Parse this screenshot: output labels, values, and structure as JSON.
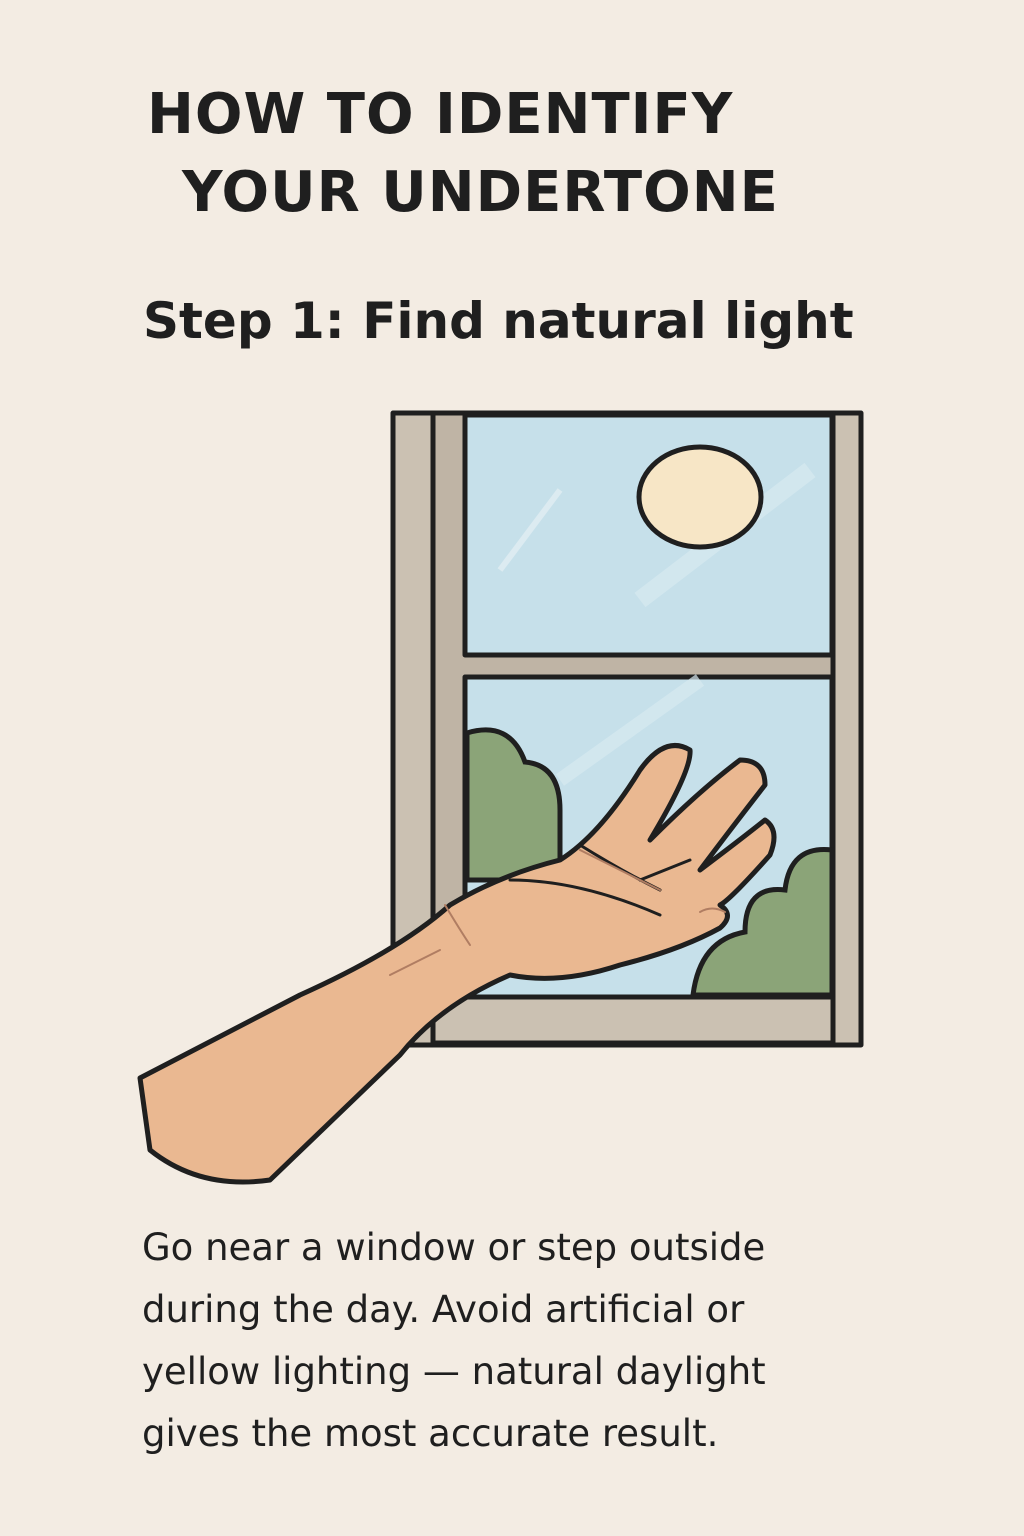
{
  "header": {
    "title_line1": "HOW TO IDENTIFY",
    "title_line2": "YOUR UNDERTONE"
  },
  "step": {
    "heading": "Step 1: Find natural light"
  },
  "illustration": {
    "icon": "hand-at-window-illustration",
    "colors": {
      "background": "#f3ece3",
      "sky": "#c6e0ea",
      "frame": "#cbc1b2",
      "sun": "#f7e6c6",
      "bush": "#8ba478",
      "skin": "#eab891",
      "outline": "#1f1f1f"
    }
  },
  "body": {
    "lines": [
      "Go near a window or step outside",
      "during the day. Avoid artificial or",
      "yellow lighting — natural daylight",
      "gives the most accurate result."
    ]
  }
}
